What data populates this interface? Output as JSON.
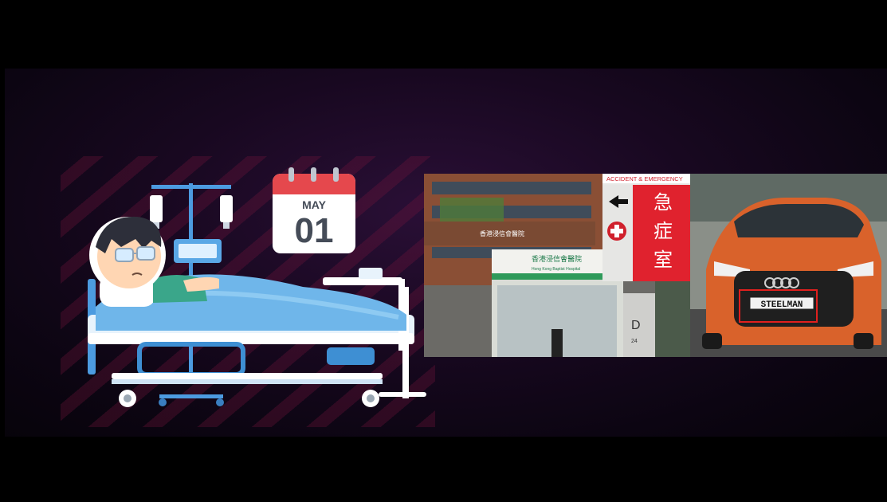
{
  "calendar": {
    "month": "MAY",
    "day": "01"
  },
  "hospital_photo": {
    "sign_banner": "ACCIDENT & EMERGENCY",
    "sign_chars": [
      "急",
      "症",
      "室"
    ],
    "building_sign": "香港浸信會醫院",
    "building_sign_en": "Hong Kong Baptist Hospital",
    "block_letter": "D",
    "block_number": "24"
  },
  "car_photo": {
    "plate": "STEELMAN",
    "highlight_color": "#e0201e"
  },
  "colors": {
    "bed": "#6fb6ea",
    "bed_dark": "#3e8fd3",
    "calendar_red": "#e5484d",
    "car_orange": "#d9622b"
  }
}
